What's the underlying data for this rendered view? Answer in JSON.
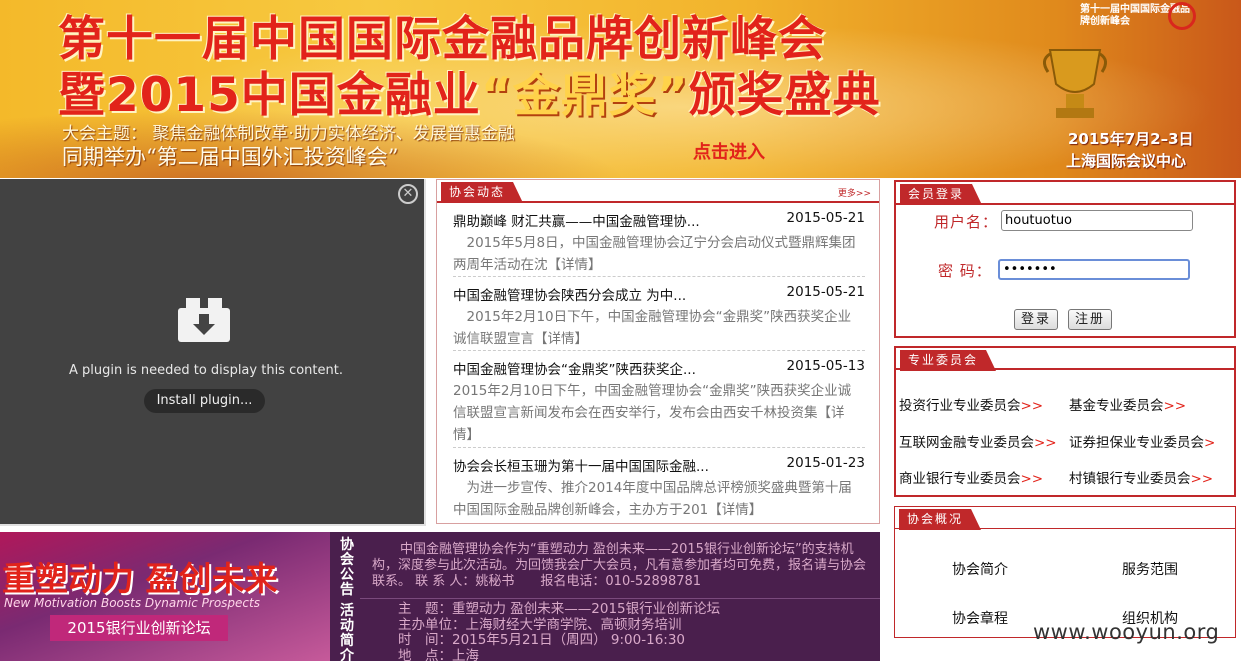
{
  "banner": {
    "line1": "第十一届中国国际金融品牌创新峰会",
    "line2_pre": "暨2015中国金融业",
    "line2_gold": "“金鼎奖”",
    "line2_post": "颁奖盛典",
    "theme": "大会主题： 聚焦金融体制改革·助力实体经济、发展普惠金融",
    "sub": "同期举办“第二届中国外汇投资峰会”",
    "enter": "点击进入",
    "logo_text": "第十一届中国国际金融品牌创新峰会",
    "date": "2015年7月2–3日",
    "venue": "上海国际会议中心"
  },
  "plugin": {
    "message": "A plugin is needed to display this content.",
    "install_label": "Install plugin..."
  },
  "news": {
    "tab": "协会动态",
    "more": "更多>>",
    "items": [
      {
        "title": "鼎助巅峰 财汇共赢——中国金融管理协...",
        "date": "2015-05-21",
        "summary": "　2015年5月8日，中国金融管理协会辽宁分会启动仪式暨鼎辉集团两周年活动在沈【详情】"
      },
      {
        "title": "中国金融管理协会陕西分会成立 为中...",
        "date": "2015-05-21",
        "summary": "　2015年2月10日下午，中国金融管理协会“金鼎奖”陕西获奖企业诚信联盟宣言【详情】"
      },
      {
        "title": "中国金融管理协会“金鼎奖”陕西获奖企...",
        "date": "2015-05-13",
        "summary": "2015年2月10日下午，中国金融管理协会“金鼎奖”陕西获奖企业诚信联盟宣言新闻发布会在西安举行，发布会由西安千林投资集【详情】"
      },
      {
        "title": "协会会长桓玉珊为第十一届中国国际金融...",
        "date": "2015-01-23",
        "summary": "　为进一步宣传、推介2014年度中国品牌总评榜颁奖盛典暨第十届中国国际金融品牌创新峰会，主办方于201【详情】"
      }
    ]
  },
  "login": {
    "tab": "会员登录",
    "username_label": "用户名：",
    "username_value": "houtuotuo",
    "password_label": "密 码：",
    "password_value": "•••••••",
    "login_button": "登录",
    "register_button": "注册"
  },
  "committee": {
    "tab": "专业委员会",
    "arrow": ">>",
    "items": [
      "投资行业专业委员会",
      "基金专业委员会",
      "互联网金融专业委员会",
      "证券担保业专业委员会",
      "商业银行专业委员会",
      "村镇银行专业委员会"
    ]
  },
  "about": {
    "tab": "协会概况",
    "items": [
      "协会简介",
      "服务范围",
      "协会章程",
      "组织机构"
    ]
  },
  "promo": {
    "ad_title": "重塑动力 盈创未来",
    "ad_english": "New Motivation Boosts Dynamic Prospects",
    "ad_badge": "2015银行业创新论坛",
    "label_notice": "协会公告",
    "label_activity": "活动简介",
    "notice": "中国金融管理协会作为“重塑动力 盈创未来——2015银行业创新论坛”的支持机构，深度参与此次活动。为回馈我会广大会员，凡有意参加者均可免费，报名请与协会联系。 联 系 人：姚秘书　　报名电话：010-52898781",
    "activity": [
      "主　题：重塑动力 盈创未来——2015银行业创新论坛",
      "主办单位：上海财经大学商学院、高顿财务培训",
      "时　间：2015年5月21日（周四） 9:00-16:30",
      "地　点：上海"
    ]
  },
  "watermark": "www.wooyun.org",
  "colors": {
    "accent": "#c0282a",
    "banner_red": "#e2231a",
    "plugin_bg": "#424242"
  }
}
